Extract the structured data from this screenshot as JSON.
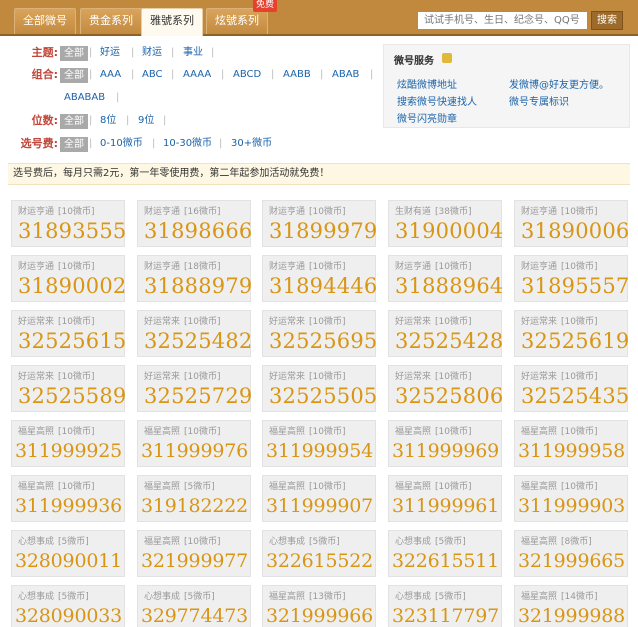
{
  "nav": {
    "tabs": [
      "全部微号",
      "贵金系列",
      "雅號系列",
      "炫號系列"
    ],
    "free_badge": "免费",
    "search_placeholder": "试试手机号、生日、纪念号、QQ号",
    "search_button": "搜索"
  },
  "filters": {
    "theme": {
      "label": "主题:",
      "options": [
        "全部",
        "好运",
        "财运",
        "事业"
      ]
    },
    "combo": {
      "label": "组合:",
      "options": [
        "全部",
        "AAA",
        "ABC",
        "AAAA",
        "ABCD",
        "AABB",
        "ABAB",
        "ABABAB"
      ]
    },
    "digits": {
      "label": "位数:",
      "options": [
        "全部",
        "8位",
        "9位"
      ]
    },
    "fee": {
      "label": "选号费:",
      "options": [
        "全部",
        "0-10微币",
        "10-30微币",
        "30+微币"
      ]
    }
  },
  "service": {
    "title": "微号服务",
    "links": [
      "炫酷微博地址",
      "发微博@好友更方便。",
      "搜索微号快速找人",
      "微号专属标识",
      "微号闪亮勋章"
    ]
  },
  "notice": "选号费后，每月只需2元，第一年零使用费，第二年起参加活动就免费！",
  "colors": {
    "nav": "#c0893e",
    "number": "#d99514",
    "label": "#c0463a",
    "link": "#1b63a8"
  },
  "cards": [
    {
      "title": "财运亨通",
      "price": "[10微币]",
      "number": "31893555"
    },
    {
      "title": "财运亨通",
      "price": "[16微币]",
      "number": "31898666"
    },
    {
      "title": "财运亨通",
      "price": "[10微币]",
      "number": "31899979"
    },
    {
      "title": "生财有道",
      "price": "[38微币]",
      "number": "31900004"
    },
    {
      "title": "财运亨通",
      "price": "[10微币]",
      "number": "31890006"
    },
    {
      "title": "财运亨通",
      "price": "[10微币]",
      "number": "31890002"
    },
    {
      "title": "财运亨通",
      "price": "[18微币]",
      "number": "31888979"
    },
    {
      "title": "财运亨通",
      "price": "[10微币]",
      "number": "31894446"
    },
    {
      "title": "财运亨通",
      "price": "[10微币]",
      "number": "31888964"
    },
    {
      "title": "财运亨通",
      "price": "[10微币]",
      "number": "31895557"
    },
    {
      "title": "好运常来",
      "price": "[10微币]",
      "number": "32525615"
    },
    {
      "title": "好运常来",
      "price": "[10微币]",
      "number": "32525482"
    },
    {
      "title": "好运常来",
      "price": "[10微币]",
      "number": "32525695"
    },
    {
      "title": "好运常来",
      "price": "[10微币]",
      "number": "32525428"
    },
    {
      "title": "好运常来",
      "price": "[10微币]",
      "number": "32525619"
    },
    {
      "title": "好运常来",
      "price": "[10微币]",
      "number": "32525589"
    },
    {
      "title": "好运常来",
      "price": "[10微币]",
      "number": "32525729"
    },
    {
      "title": "好运常来",
      "price": "[10微币]",
      "number": "32525505"
    },
    {
      "title": "好运常来",
      "price": "[10微币]",
      "number": "32525806"
    },
    {
      "title": "好运常来",
      "price": "[10微币]",
      "number": "32525435"
    },
    {
      "title": "福星高照",
      "price": "[10微币]",
      "number": "311999925"
    },
    {
      "title": "福星高照",
      "price": "[10微币]",
      "number": "311999976"
    },
    {
      "title": "福星高照",
      "price": "[10微币]",
      "number": "311999954"
    },
    {
      "title": "福星高照",
      "price": "[10微币]",
      "number": "311999969"
    },
    {
      "title": "福星高照",
      "price": "[10微币]",
      "number": "311999958"
    },
    {
      "title": "福星高照",
      "price": "[10微币]",
      "number": "311999936"
    },
    {
      "title": "福星高照",
      "price": "[5微币]",
      "number": "319182222"
    },
    {
      "title": "福星高照",
      "price": "[10微币]",
      "number": "311999907"
    },
    {
      "title": "福星高照",
      "price": "[10微币]",
      "number": "311999961"
    },
    {
      "title": "福星高照",
      "price": "[10微币]",
      "number": "311999903"
    },
    {
      "title": "心想事成",
      "price": "[5微币]",
      "number": "328090011"
    },
    {
      "title": "福星高照",
      "price": "[10微币]",
      "number": "321999977"
    },
    {
      "title": "心想事成",
      "price": "[5微币]",
      "number": "322615522"
    },
    {
      "title": "心想事成",
      "price": "[5微币]",
      "number": "322615511"
    },
    {
      "title": "福星高照",
      "price": "[8微币]",
      "number": "321999665"
    },
    {
      "title": "心想事成",
      "price": "[5微币]",
      "number": "328090033"
    },
    {
      "title": "心想事成",
      "price": "[5微币]",
      "number": "329774473"
    },
    {
      "title": "福星高照",
      "price": "[13微币]",
      "number": "321999966"
    },
    {
      "title": "心想事成",
      "price": "[5微币]",
      "number": "323117797"
    },
    {
      "title": "福星高照",
      "price": "[14微币]",
      "number": "321999988"
    }
  ]
}
